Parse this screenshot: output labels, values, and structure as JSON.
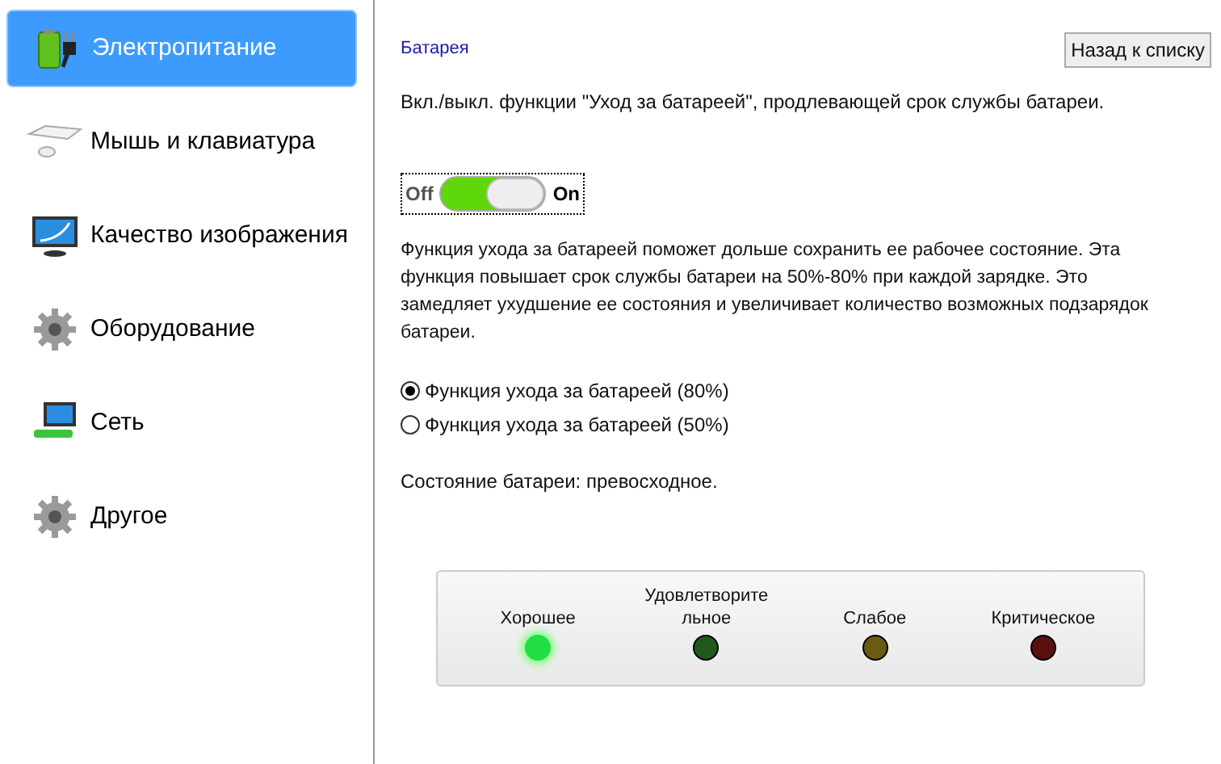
{
  "sidebar": {
    "items": [
      {
        "label": "Электропитание",
        "selected": true
      },
      {
        "label": "Мышь и клавиатура",
        "selected": false
      },
      {
        "label": "Качество изображения",
        "selected": false
      },
      {
        "label": "Оборудование",
        "selected": false
      },
      {
        "label": "Сеть",
        "selected": false
      },
      {
        "label": "Другое",
        "selected": false
      }
    ]
  },
  "content": {
    "title": "Батарея",
    "back_button": "Назад к списку",
    "description": "Вкл./выкл. функции \"Уход за батареей\", продлевающей срок службы батареи.",
    "toggle": {
      "off_label": "Off",
      "on_label": "On",
      "on": true
    },
    "info": "Функция ухода за батареей поможет дольше сохранить ее рабочее состояние. Эта функция повышает срок службы батареи на 50%-80% при каждой зарядке. Это замедляет ухудшение ее состояния и увеличивает количество возможных подзарядок батареи.",
    "options": [
      {
        "label": "Функция ухода за батареей (80%)",
        "selected": true
      },
      {
        "label": "Функция ухода за батареей (50%)",
        "selected": false
      }
    ],
    "status": "Состояние батареи: превосходное.",
    "indicators": [
      {
        "label": "Хорошее",
        "color": "#22dd44",
        "lit": true
      },
      {
        "label": "Удовлетворительное",
        "color": "#1f5a1a",
        "lit": false
      },
      {
        "label": "Слабое",
        "color": "#6b5a12",
        "lit": false
      },
      {
        "label": "Критическое",
        "color": "#5a1010",
        "lit": false
      }
    ]
  }
}
